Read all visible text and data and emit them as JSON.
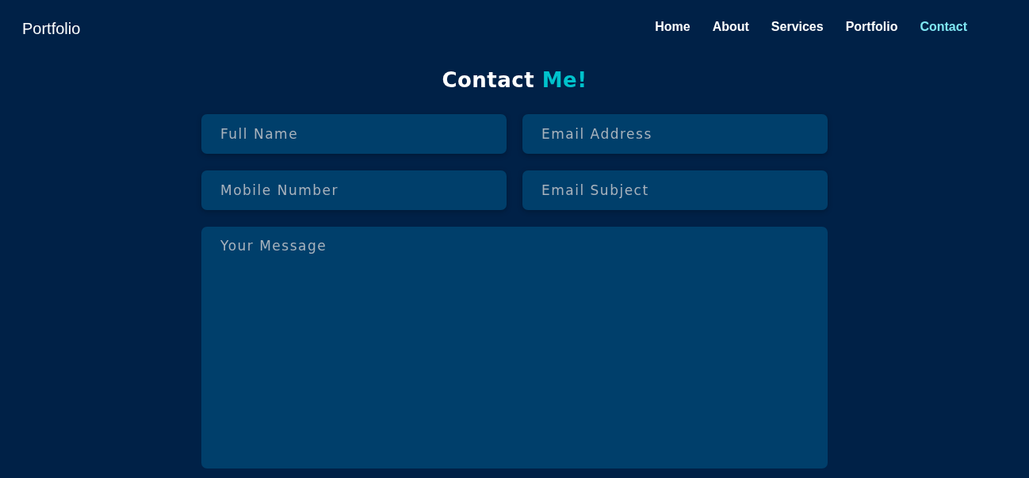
{
  "header": {
    "logo": "Portfolio",
    "nav": [
      {
        "label": "Home",
        "selected": false
      },
      {
        "label": "About",
        "selected": false
      },
      {
        "label": "Services",
        "selected": false
      },
      {
        "label": "Portfolio",
        "selected": false
      },
      {
        "label": "Contact",
        "selected": true
      }
    ]
  },
  "heading": {
    "text": "Contact",
    "accent": "Me!"
  },
  "form": {
    "fields": [
      {
        "placeholder": "Full Name",
        "kind": "input"
      },
      {
        "placeholder": "Email Address",
        "kind": "input"
      },
      {
        "placeholder": "Mobile Number",
        "kind": "input"
      },
      {
        "placeholder": "Email Subject",
        "kind": "input"
      },
      {
        "placeholder": "Your Message",
        "kind": "textarea"
      }
    ]
  }
}
